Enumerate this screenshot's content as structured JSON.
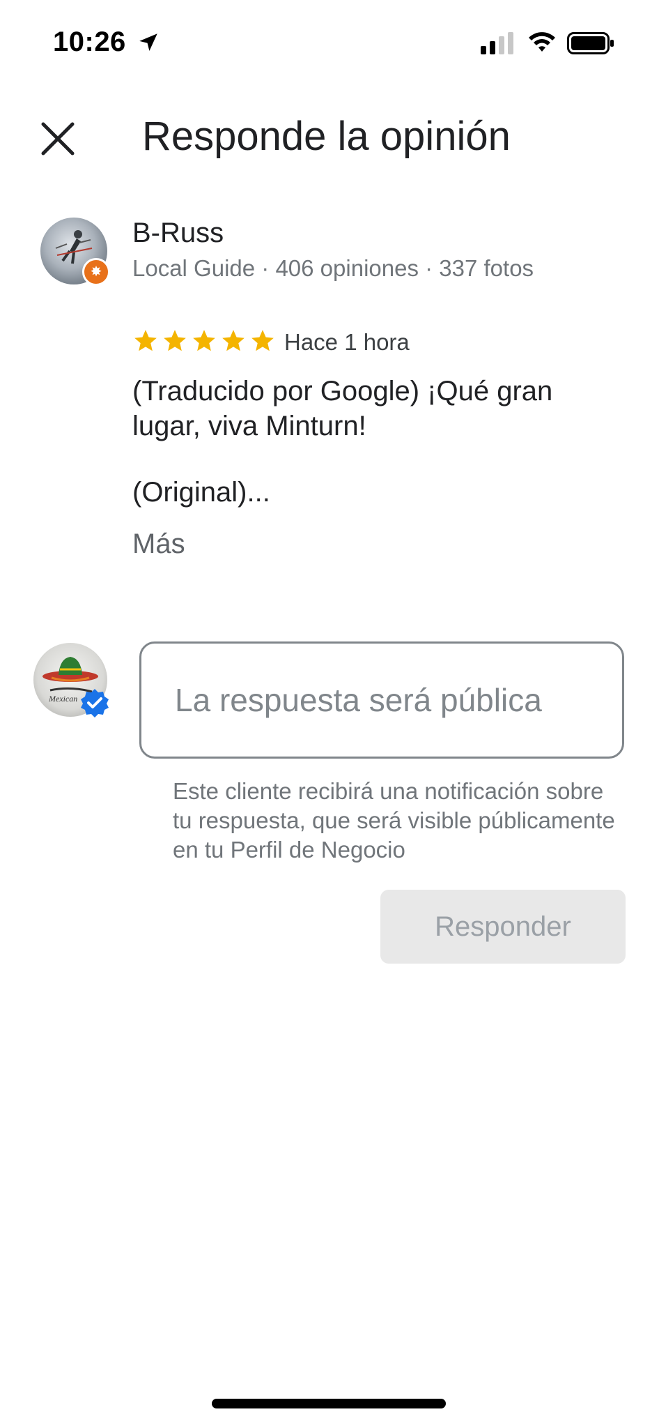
{
  "status_bar": {
    "time": "10:26",
    "icons": [
      "location-arrow-icon",
      "cellular-signal-icon",
      "wifi-icon",
      "battery-icon"
    ]
  },
  "header": {
    "title": "Responde la opinión",
    "close_icon": "close-icon"
  },
  "review": {
    "reviewer_name": "B-Russ",
    "reviewer_meta": "Local Guide · 406 opiniones · 337 fotos",
    "rating": 5,
    "rating_max": 5,
    "time_ago": "Hace 1 hora",
    "text": "(Traducido por Google) ¡Qué gran lugar, viva Minturn!",
    "original_label": "(Original)...",
    "more_label": "Más"
  },
  "reply": {
    "placeholder": "La respuesta será pública",
    "value": "",
    "notice": "Este cliente recibirá una notificación sobre tu respuesta, que será visible públicamente en tu Perfil de Negocio",
    "submit_label": "Responder"
  },
  "colors": {
    "star": "#f4b400",
    "verified": "#1a73e8",
    "local_guide_badge": "#e8711a",
    "disabled_button_bg": "#e8e8e8",
    "disabled_button_text": "#9aa0a6"
  }
}
